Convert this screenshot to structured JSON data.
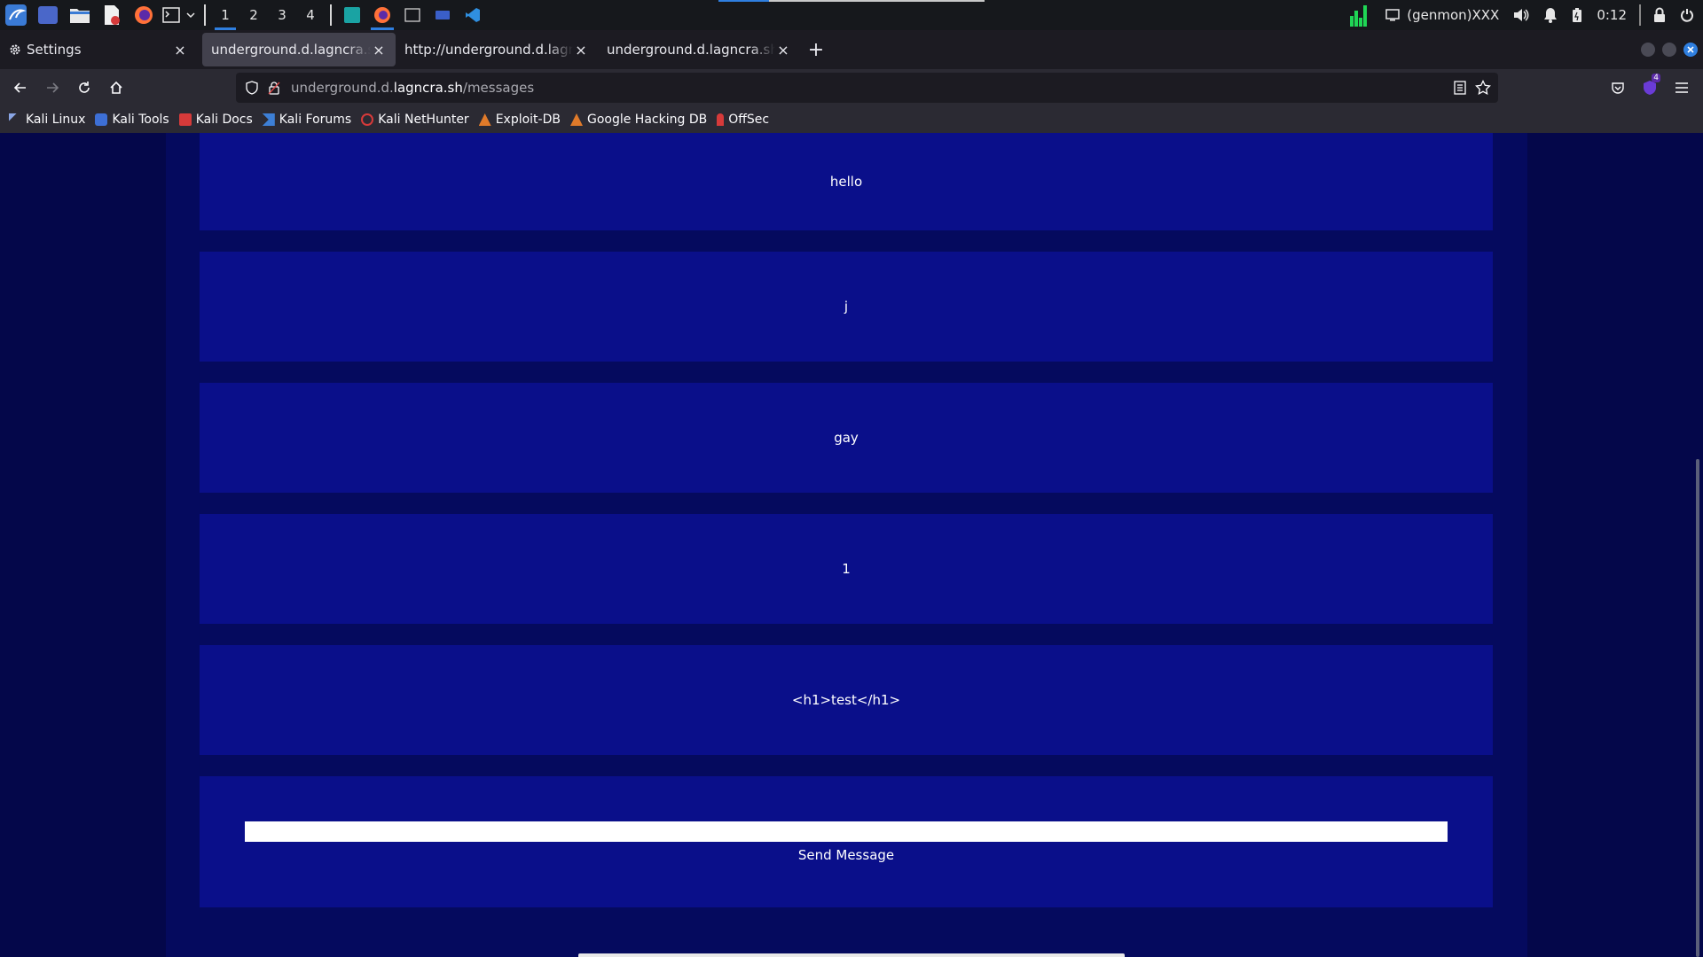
{
  "taskbar": {
    "workspaces": [
      "1",
      "2",
      "3",
      "4"
    ],
    "active_workspace": "1",
    "genmon": "(genmon)XXX",
    "clock": "0:12",
    "progress_fraction": 0.19
  },
  "tabs": [
    {
      "label": "Settings",
      "icon": "gear-icon",
      "active": false
    },
    {
      "label": "underground.d.lagncra.sh/messages",
      "active": true
    },
    {
      "label": "http://underground.d.lagncra.sh/",
      "active": false
    },
    {
      "label": "underground.d.lagncra.sh/status",
      "active": false
    }
  ],
  "urlbar": {
    "prefix": "underground.d.",
    "host": "lagncra.sh",
    "path": "/messages"
  },
  "extension_badge": "4",
  "bookmarks": [
    {
      "label": "Kali Linux",
      "icon": "kali-dragon-icon",
      "color": "#6b8fd6"
    },
    {
      "label": "Kali Tools",
      "icon": "kali-tools-icon",
      "color": "#3d6fd6"
    },
    {
      "label": "Kali Docs",
      "icon": "kali-docs-icon",
      "color": "#d63a3a"
    },
    {
      "label": "Kali Forums",
      "icon": "kali-forums-icon",
      "color": "#3d7fd6"
    },
    {
      "label": "Kali NetHunter",
      "icon": "nethunter-icon",
      "color": "#d63a3a"
    },
    {
      "label": "Exploit-DB",
      "icon": "exploit-db-icon",
      "color": "#e07a2a"
    },
    {
      "label": "Google Hacking DB",
      "icon": "ghdb-icon",
      "color": "#e07a2a"
    },
    {
      "label": "OffSec",
      "icon": "offsec-icon",
      "color": "#d63a3a"
    }
  ],
  "messages": [
    "hello",
    "j",
    "gay",
    "1",
    "<h1>test</h1>"
  ],
  "composer": {
    "input_value": "",
    "send_label": "Send Message"
  },
  "colors": {
    "page_bg": "#04074a",
    "column_bg": "#050a5e",
    "card_bg": "#0a0f8a",
    "accent": "#2f7fe0"
  }
}
